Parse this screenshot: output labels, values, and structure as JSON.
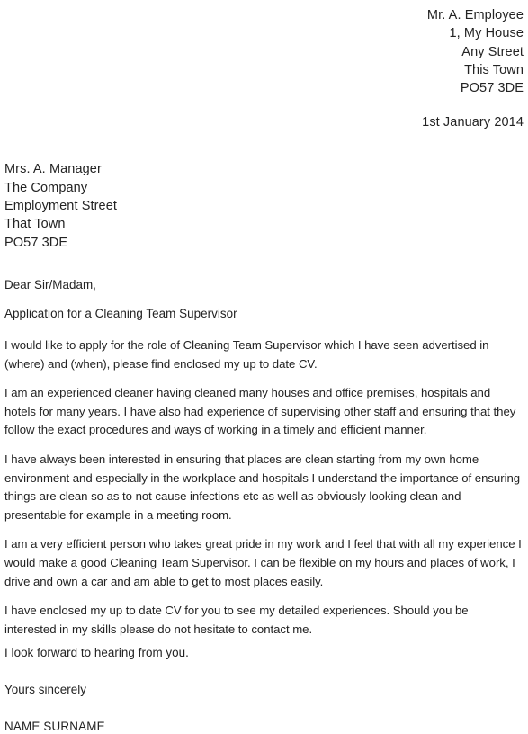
{
  "document": {
    "type": "cover-letter",
    "text_color": "#232323",
    "background_color": "#ffffff"
  },
  "sender_address": {
    "lines": [
      "Mr. A. Employee",
      "1, My House",
      "Any Street",
      "This Town",
      "PO57 3DE"
    ]
  },
  "date": {
    "value": "1st January 2014"
  },
  "recipient_address": {
    "lines": [
      "Mrs. A. Manager",
      "The Company",
      "Employment Street",
      "That Town",
      "PO57 3DE"
    ]
  },
  "salutation": {
    "text": "Dear Sir/Madam,"
  },
  "subject": {
    "text": "Application for a Cleaning Team Supervisor"
  },
  "body": {
    "paragraphs": [
      "I would like to apply for the role of Cleaning Team Supervisor which I have seen advertised in (where) and (when), please find enclosed my up to date CV.",
      "I am an experienced cleaner having cleaned many houses and office premises, hospitals and hotels for many years. I have also had experience of supervising other staff and ensuring that they follow the exact procedures and ways of working in a timely and efficient manner.",
      "I have always been interested in ensuring that places are clean starting from my own home environment and especially in the workplace and hospitals I understand the importance of ensuring things are clean so as to not cause infections etc as well as obviously looking clean and presentable for example in a meeting room.",
      "I am a very efficient person who takes great pride in my work and I feel that with all my experience I would make a good Cleaning Team Supervisor. I can be flexible on my hours and places of work, I drive and own a car and am able to get to most places easily.",
      "I have enclosed my up to date CV for you to see my detailed experiences. Should you be interested in my skills please do not hesitate to contact me."
    ]
  },
  "closing": {
    "forward_line": "I look forward to hearing from you.",
    "sign_off": "Yours sincerely",
    "signature_name": "NAME SURNAME"
  }
}
